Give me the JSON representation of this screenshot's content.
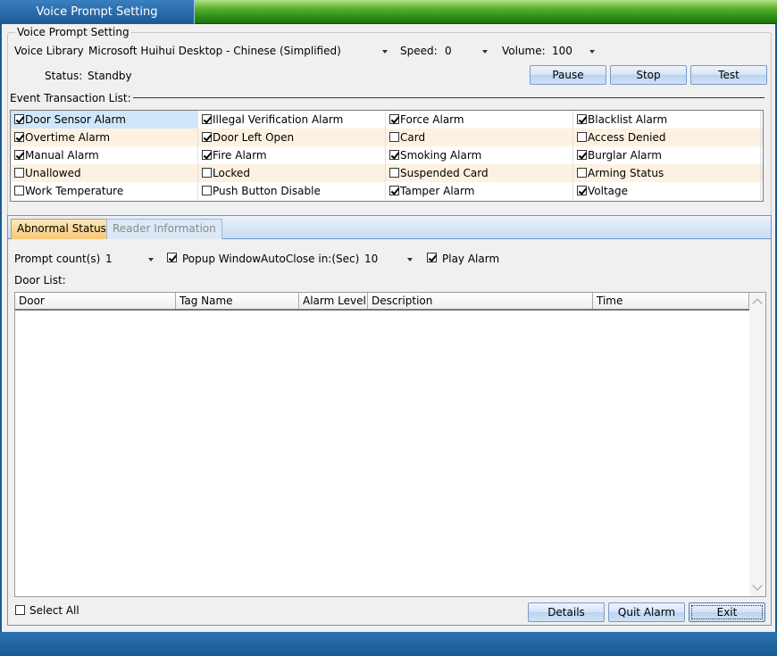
{
  "window": {
    "title": "Voice Prompt Setting"
  },
  "voice": {
    "group_title": "Voice Prompt Setting",
    "library_label": "Voice Library:",
    "library_value": "Microsoft Huihui Desktop - Chinese (Simplified)",
    "speed_label": "Speed:",
    "speed_value": "0",
    "volume_label": "Volume:",
    "volume_value": "100",
    "status_label": "Status:",
    "status_value": "Standby",
    "pause_label": "Pause",
    "stop_label": "Stop",
    "test_label": "Test"
  },
  "events": {
    "title": "Event Transaction List:",
    "rows": [
      [
        {
          "label": "Door Sensor Alarm",
          "checked": true
        },
        {
          "label": "Illegal Verification Alarm",
          "checked": true
        },
        {
          "label": "Force Alarm",
          "checked": true
        },
        {
          "label": "Blacklist Alarm",
          "checked": true
        }
      ],
      [
        {
          "label": "Overtime Alarm",
          "checked": true
        },
        {
          "label": "Door Left Open",
          "checked": true
        },
        {
          "label": "Card",
          "checked": false
        },
        {
          "label": "Access Denied",
          "checked": false
        }
      ],
      [
        {
          "label": "Manual Alarm",
          "checked": true
        },
        {
          "label": "Fire Alarm",
          "checked": true
        },
        {
          "label": "Smoking Alarm",
          "checked": true
        },
        {
          "label": "Burglar Alarm",
          "checked": true
        }
      ],
      [
        {
          "label": "Unallowed",
          "checked": false
        },
        {
          "label": "Locked",
          "checked": false
        },
        {
          "label": "Suspended Card",
          "checked": false
        },
        {
          "label": "Arming Status",
          "checked": false
        }
      ],
      [
        {
          "label": "Work Temperature",
          "checked": false
        },
        {
          "label": "Push Button Disable",
          "checked": false
        },
        {
          "label": "Tamper Alarm",
          "checked": true
        },
        {
          "label": "Voltage",
          "checked": true
        }
      ]
    ]
  },
  "tabs": [
    {
      "label": "Abnormal Status",
      "active": true
    },
    {
      "label": "Reader Information",
      "active": false
    }
  ],
  "abnormal": {
    "prompt_count_label": "Prompt count(s):",
    "prompt_count_value": "1",
    "popup_label": "Popup Window",
    "popup_checked": true,
    "autoclose_label": "AutoClose in:(Sec):",
    "autoclose_value": "10",
    "play_alarm_label": "Play Alarm",
    "play_alarm_checked": true,
    "door_list_label": "Door List:",
    "columns": [
      "Door",
      "Tag Name",
      "Alarm Level",
      "Description",
      "Time"
    ],
    "select_all_label": "Select All",
    "select_all_checked": false,
    "details_label": "Details",
    "quit_alarm_label": "Quit Alarm",
    "exit_label": "Exit"
  }
}
